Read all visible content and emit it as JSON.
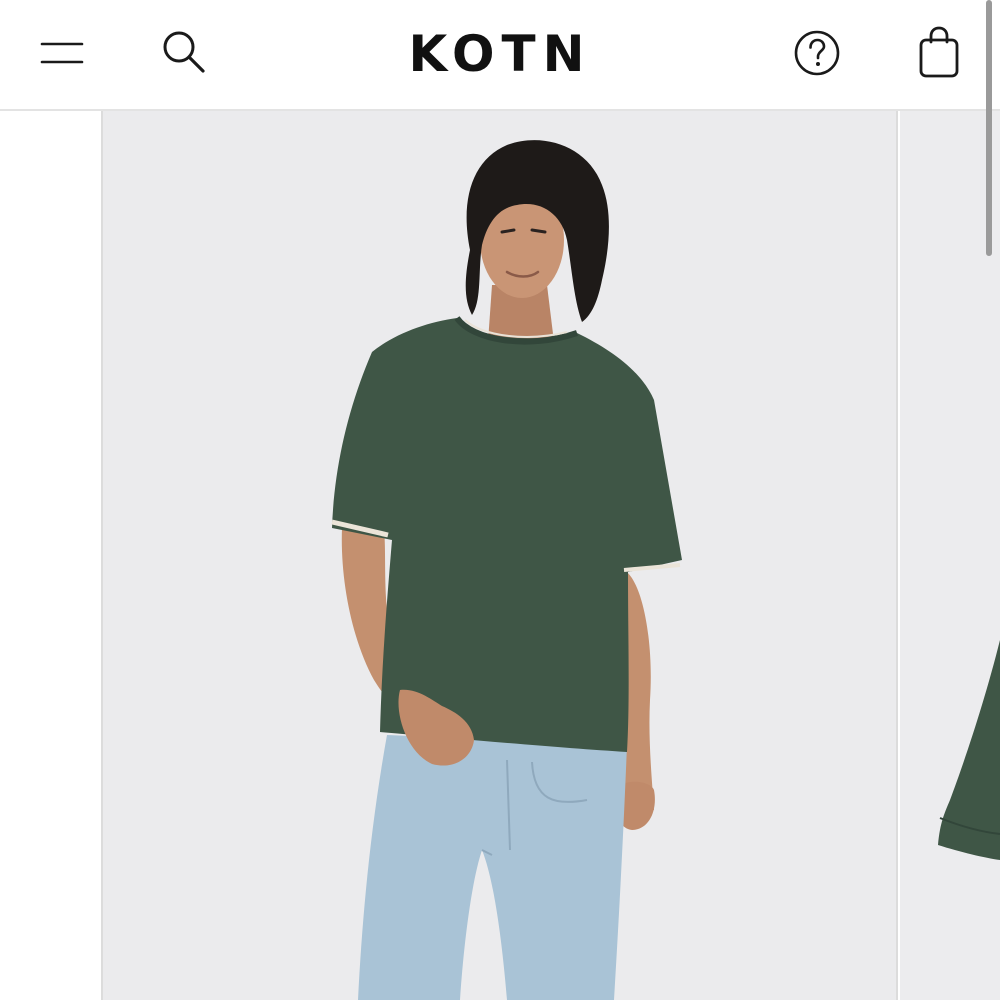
{
  "header": {
    "logo_text": "KOTN",
    "icons": {
      "menu": "hamburger-menu-icon",
      "search": "search-icon",
      "help": "help-circle-icon",
      "bag": "shopping-bag-icon"
    }
  },
  "product_carousel": {
    "main_image": {
      "subject": "model-wearing-green-tee",
      "colors": {
        "background": "#ebebed",
        "tee": "#3f5646",
        "jeans": "#a9c3d6",
        "skin": "#c99575",
        "hair": "#1e1a18"
      }
    },
    "next_image": {
      "colors": {
        "tee": "#3f5646"
      }
    }
  }
}
